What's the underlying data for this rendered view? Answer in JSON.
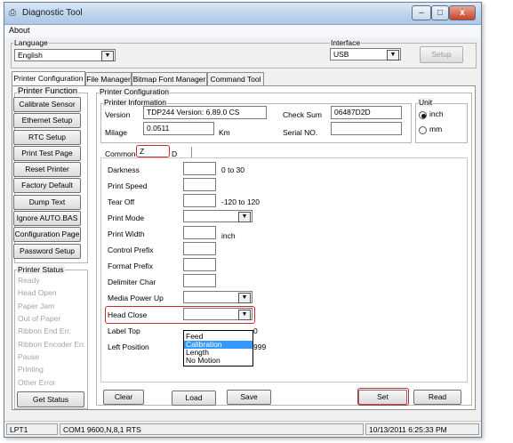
{
  "window": {
    "title": "Diagnostic Tool",
    "minimize": "–",
    "maximize": "□",
    "close": "x"
  },
  "menu": {
    "about": "About"
  },
  "language": {
    "label": "Language",
    "value": "English"
  },
  "interface": {
    "label": "Interface",
    "value": "USB",
    "setup": "Setup"
  },
  "tabs": [
    "Printer Configuration",
    "File Manager",
    "Bitmap Font Manager",
    "Command Tool"
  ],
  "printer_function": {
    "label": "Printer Function",
    "buttons": [
      "Calibrate Sensor",
      "Ethernet Setup",
      "RTC Setup",
      "Print Test Page",
      "Reset Printer",
      "Factory Default",
      "Dump Text",
      "Ignore AUTO.BAS",
      "Configuration Page",
      "Password Setup"
    ]
  },
  "printer_status": {
    "label": "Printer Status",
    "items": [
      "Ready",
      "Head Open",
      "Paper Jam",
      "Out of Paper",
      "Ribbon End Err.",
      "Ribbon Encoder Err.",
      "Pause",
      "Printing",
      "Other Error"
    ],
    "get_status": "Get Status"
  },
  "config": {
    "label": "Printer Configuration",
    "info_label": "Printer Information",
    "version_label": "Version",
    "version_value": "TDP244 Version: 6.89.0 CS",
    "checksum_label": "Check Sum",
    "checksum_value": "06487D2D",
    "milage_label": "Milage",
    "milage_value": "0.0511",
    "milage_unit": "Km",
    "serial_label": "Serial NO.",
    "serial_value": "",
    "unit_label": "Unit",
    "unit_inch": "inch",
    "unit_mm": "mm",
    "unit_selected": "inch",
    "subtabs": [
      "Common",
      "Z",
      "D"
    ],
    "fields": [
      {
        "label": "Darkness",
        "hint": "0 to 30"
      },
      {
        "label": "Print Speed",
        "hint": ""
      },
      {
        "label": "Tear Off",
        "hint": "-120 to 120"
      },
      {
        "label": "Print Mode",
        "hint": ""
      },
      {
        "label": "Print Width",
        "hint": "inch"
      },
      {
        "label": "Control Prefix",
        "hint": ""
      },
      {
        "label": "Format Prefix",
        "hint": ""
      },
      {
        "label": "Delimiter Char",
        "hint": ""
      },
      {
        "label": "Media Power Up",
        "hint": ""
      },
      {
        "label": "Head Close",
        "hint": ""
      },
      {
        "label": "Label Top",
        "hint": "0"
      },
      {
        "label": "Left Position",
        "hint": "999"
      }
    ],
    "head_close_options": [
      "Feed",
      "Calibration",
      "Length",
      "No Motion"
    ],
    "head_close_highlighted": "Calibration",
    "buttons": {
      "clear": "Clear",
      "load": "Load",
      "save": "Save",
      "set": "Set",
      "read": "Read"
    }
  },
  "status_bar": {
    "port": "LPT1",
    "settings": "COM1 9600,N,8,1 RTS",
    "datetime": "10/13/2011 6:25:33 PM"
  }
}
